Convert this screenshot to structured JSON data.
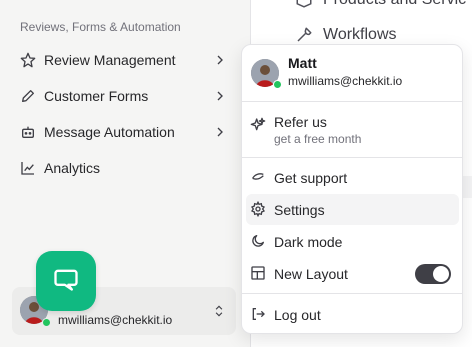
{
  "sidebar": {
    "section_title": "Reviews, Forms & Automation",
    "items": [
      {
        "label": "Review Management",
        "icon": "star-icon",
        "has_submenu": true
      },
      {
        "label": "Customer Forms",
        "icon": "pencil-icon",
        "has_submenu": true
      },
      {
        "label": "Message Automation",
        "icon": "bot-icon",
        "has_submenu": true
      },
      {
        "label": "Analytics",
        "icon": "line-chart-icon",
        "has_submenu": false
      }
    ],
    "user": {
      "email": "mwilliams@chekkit.io",
      "status": "online"
    }
  },
  "main": {
    "items": [
      {
        "label": "Products and Servic",
        "icon": "box-icon"
      },
      {
        "label": "Workflows",
        "icon": "wrench-icon"
      }
    ]
  },
  "user_menu": {
    "name": "Matt",
    "email": "mwilliams@chekkit.io",
    "refer": {
      "label": "Refer us",
      "sublabel": "get a free month"
    },
    "items": [
      {
        "label": "Get support",
        "icon": "life-buoy-icon"
      },
      {
        "label": "Settings",
        "icon": "gear-icon"
      },
      {
        "label": "Dark mode",
        "icon": "moon-icon"
      },
      {
        "label": "New Layout",
        "icon": "layout-icon",
        "toggle": true
      }
    ],
    "logout": "Log out"
  },
  "colors": {
    "accent": "#10b981",
    "online": "#22c55e",
    "toggle_on": "#3f3f46"
  }
}
